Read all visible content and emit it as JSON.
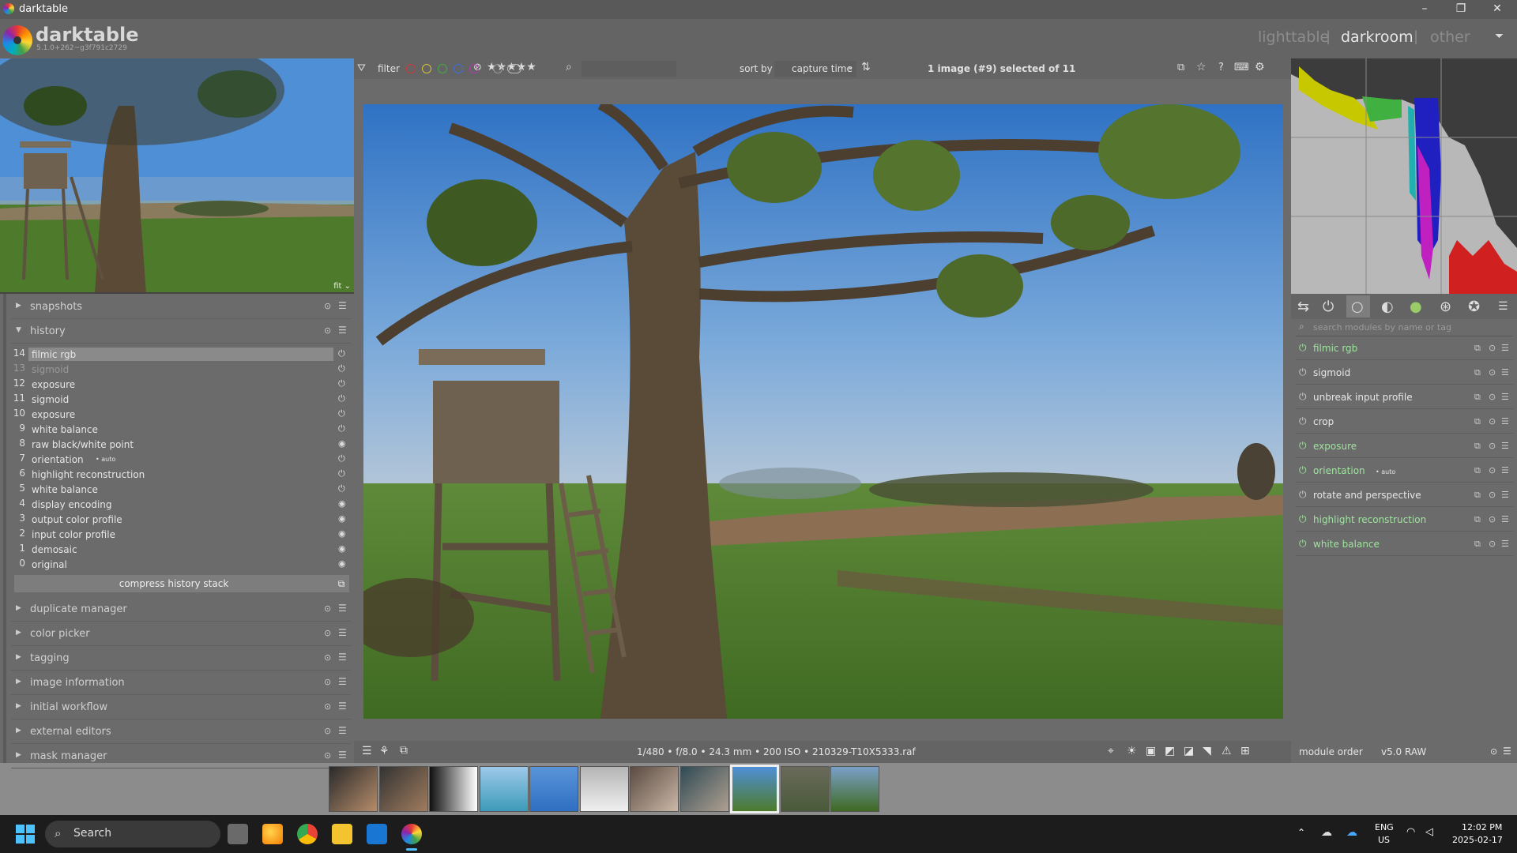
{
  "window": {
    "title": "darktable",
    "controls": [
      "–",
      "❐",
      "✕"
    ]
  },
  "header": {
    "app_name": "darktable",
    "version": "5.1.0+262~g3f791c2729",
    "views": [
      "lighttable",
      "darkroom",
      "other"
    ],
    "active_view": "darkroom",
    "view_separator": "|",
    "dropdown_glyph": "⏷"
  },
  "navigation": {
    "zoom": "fit ⌄"
  },
  "left_sections_top": [
    {
      "label": "snapshots",
      "expanded": false
    },
    {
      "label": "history",
      "expanded": true
    }
  ],
  "history": {
    "items": [
      {
        "num": "14",
        "name": "filmic rgb",
        "selected": true,
        "disabled": false,
        "icon": "power"
      },
      {
        "num": "13",
        "name": "sigmoid",
        "selected": false,
        "disabled": true,
        "icon": "power"
      },
      {
        "num": "12",
        "name": "exposure",
        "selected": false,
        "disabled": false,
        "icon": "power"
      },
      {
        "num": "11",
        "name": "sigmoid",
        "selected": false,
        "disabled": false,
        "icon": "power"
      },
      {
        "num": "10",
        "name": "exposure",
        "selected": false,
        "disabled": false,
        "icon": "power"
      },
      {
        "num": "9",
        "name": "white balance",
        "selected": false,
        "disabled": false,
        "icon": "power"
      },
      {
        "num": "8",
        "name": "raw black/white point",
        "selected": false,
        "disabled": false,
        "icon": "always-on"
      },
      {
        "num": "7",
        "name": "orientation",
        "suffix": "• auto",
        "selected": false,
        "disabled": false,
        "icon": "power"
      },
      {
        "num": "6",
        "name": "highlight reconstruction",
        "selected": false,
        "disabled": false,
        "icon": "power"
      },
      {
        "num": "5",
        "name": "white balance",
        "selected": false,
        "disabled": false,
        "icon": "power"
      },
      {
        "num": "4",
        "name": "display encoding",
        "selected": false,
        "disabled": false,
        "icon": "always-on"
      },
      {
        "num": "3",
        "name": "output color profile",
        "selected": false,
        "disabled": false,
        "icon": "always-on"
      },
      {
        "num": "2",
        "name": "input color profile",
        "selected": false,
        "disabled": false,
        "icon": "always-on"
      },
      {
        "num": "1",
        "name": "demosaic",
        "selected": false,
        "disabled": false,
        "icon": "always-on"
      },
      {
        "num": "0",
        "name": "original",
        "selected": false,
        "disabled": false,
        "icon": "always-on"
      }
    ],
    "compress_label": "compress history stack"
  },
  "left_sections_bottom": [
    {
      "label": "duplicate manager"
    },
    {
      "label": "color picker"
    },
    {
      "label": "tagging"
    },
    {
      "label": "image information"
    },
    {
      "label": "initial workflow"
    },
    {
      "label": "external editors"
    },
    {
      "label": "mask manager"
    }
  ],
  "filterbar": {
    "filter_label": "filter",
    "color_labels": [
      "#d23a3a",
      "#d8c23a",
      "#3fae3f",
      "#3a6fd8",
      "#b03ab0"
    ],
    "rating": "★★★★★",
    "sort_label": "sort by",
    "sort_value": "capture time",
    "selection": "1 image (#9) selected of 11"
  },
  "image_info": "1/480 • f/8.0 • 24.3 mm • 200 ISO • 210329-T10X5333.raf",
  "right": {
    "search_placeholder": "search modules by name or tag",
    "modules": [
      {
        "name": "filmic rgb",
        "on": true
      },
      {
        "name": "sigmoid",
        "on": false
      },
      {
        "name": "unbreak input profile",
        "on": false
      },
      {
        "name": "crop",
        "on": false
      },
      {
        "name": "exposure",
        "on": true
      },
      {
        "name": "orientation",
        "suffix": "• auto",
        "on": true
      },
      {
        "name": "rotate and perspective",
        "on": false
      },
      {
        "name": "highlight reconstruction",
        "on": true
      },
      {
        "name": "white balance",
        "on": true
      }
    ],
    "module_order_label": "module order",
    "module_order_value": "v5.0 RAW"
  },
  "filmstrip": {
    "count": 11,
    "selected_index": 8
  },
  "taskbar": {
    "search_label": "Search",
    "lang_top": "ENG",
    "lang_bottom": "US",
    "time": "12:02 PM",
    "date": "2025-02-17"
  }
}
